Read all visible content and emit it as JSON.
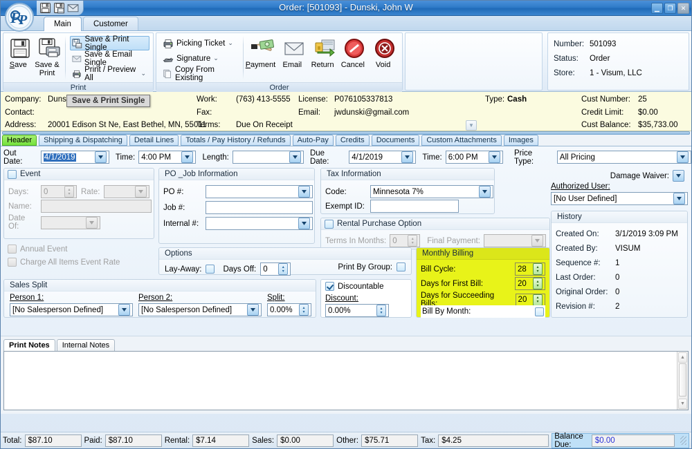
{
  "window": {
    "title": "Order: [501093] - Dunski, John W",
    "minimize": "_",
    "maximize": "□",
    "close": "✕",
    "quick_access": [
      "save-icon",
      "save-print-icon",
      "email-icon"
    ],
    "logo": "fp-magnifier-logo"
  },
  "ribbon": {
    "tabs": [
      {
        "label": "Main",
        "active": true
      },
      {
        "label": "Customer",
        "active": false
      }
    ],
    "groups": [
      {
        "title": "Print",
        "big_buttons": [
          {
            "label_line1": "Save",
            "label_line2": "",
            "icon": "floppy-disk-icon",
            "underline_index": 0
          },
          {
            "label_line1": "Save &",
            "label_line2": "Print",
            "icon": "floppy-printer-icon"
          }
        ],
        "small_buttons": [
          {
            "label": "Save & Print Single",
            "icon": "save-print-single-icon",
            "selected": true,
            "caret": false
          },
          {
            "label": "Save & Email Single",
            "icon": "envelope-icon",
            "selected": false,
            "caret": false
          },
          {
            "label": "Print / Preview All",
            "icon": "printer-icon",
            "selected": false,
            "caret": true
          }
        ]
      },
      {
        "title": "Order",
        "small_buttons": [
          {
            "label": "Picking Ticket",
            "icon": "printer-icon",
            "caret": true
          },
          {
            "label": "Signature",
            "icon": "signature-pad-icon",
            "caret": true
          },
          {
            "label": "Copy From Existing",
            "icon": "copy-document-icon",
            "caret": false
          }
        ],
        "big_buttons": [
          {
            "label_line1": "Payment",
            "icon": "money-hand-icon",
            "underline_index": 0
          },
          {
            "label_line1": "Email",
            "icon": "envelope-icon"
          },
          {
            "label_line1": "Return",
            "icon": "return-box-icon"
          },
          {
            "label_line1": "Cancel",
            "icon": "cancel-circle-icon"
          },
          {
            "label_line1": "Void",
            "icon": "void-circle-icon"
          }
        ]
      }
    ],
    "info": {
      "rows": [
        {
          "key": "Number:",
          "value": "501093"
        },
        {
          "key": "Status:",
          "value": "Order"
        },
        {
          "key": "Store:",
          "value": "1 - Visum, LLC"
        }
      ]
    }
  },
  "tooltip": {
    "text": "Save & Print Single"
  },
  "customer_header": {
    "company_label": "Company:",
    "company_value": "Dunski, John W",
    "contact_label": "Contact:",
    "contact_value": "",
    "address_label": "Address:",
    "address_value": "20001 Edison St Ne, East Bethel, MN, 55011",
    "work_label": "Work:",
    "work_value": "(763) 413-5555",
    "fax_label": "Fax:",
    "fax_value": "",
    "terms_label": "Terms:",
    "terms_value": "Due On Receipt",
    "license_label": "License:",
    "license_value": "P076105337813",
    "email_label": "Email:",
    "email_value": "jwdunski@gmail.com",
    "type_label": "Type:",
    "type_value": "Cash",
    "cust_number_label": "Cust Number:",
    "cust_number_value": "25",
    "credit_limit_label": "Credit Limit:",
    "credit_limit_value": "$0.00",
    "cust_balance_label": "Cust Balance:",
    "cust_balance_value": "$35,733.00"
  },
  "page_tabs": [
    {
      "label": "Header",
      "active": true
    },
    {
      "label": "Shipping & Dispatching",
      "active": false
    },
    {
      "label": "Detail Lines",
      "active": false
    },
    {
      "label": "Totals / Pay History / Refunds",
      "active": false
    },
    {
      "label": "Auto-Pay",
      "active": false
    },
    {
      "label": "Credits",
      "active": false
    },
    {
      "label": "Documents",
      "active": false
    },
    {
      "label": "Custom Attachments",
      "active": false
    },
    {
      "label": "Images",
      "active": false
    }
  ],
  "header_tab": {
    "out_date_label": "Out Date:",
    "out_date_value": "4/1/2019",
    "out_time_label": "Time:",
    "out_time_value": "4:00 PM",
    "length_label": "Length:",
    "length_value": "",
    "due_date_label": "Due Date:",
    "due_date_value": "4/1/2019",
    "due_time_label": "Time:",
    "due_time_value": "6:00 PM",
    "price_type_label": "Price Type:",
    "price_type_value": "All Pricing",
    "event": {
      "title": "Event",
      "checked": false,
      "days_label": "Days:",
      "days_value": "0",
      "rate_label": "Rate:",
      "rate_value": "",
      "name_label": "Name:",
      "name_value": "",
      "date_of_label": "Date Of:",
      "date_of_value": "",
      "annual_event_label": "Annual Event",
      "annual_event_checked": false,
      "charge_all_label": "Charge All Items Event Rate",
      "charge_all_checked": false
    },
    "po_job": {
      "title": "PO _Job Information",
      "po_label": "PO #:",
      "po_value": "",
      "job_label": "Job #:",
      "job_value": "",
      "internal_label": "Internal #:",
      "internal_value": ""
    },
    "tax": {
      "title": "Tax Information",
      "code_label": "Code:",
      "code_value": "Minnesota 7%",
      "exempt_label": "Exempt ID:",
      "exempt_value": ""
    },
    "rpo": {
      "title": "Rental Purchase Option",
      "checked": false,
      "terms_label": "Terms In Months:",
      "terms_value": "0",
      "final_label": "Final Payment:",
      "final_value": ""
    },
    "options": {
      "title": "Options",
      "layaway_label": "Lay-Away:",
      "layaway_checked": false,
      "days_off_label": "Days Off:",
      "days_off_value": "0",
      "print_by_group_label": "Print By Group:",
      "print_by_group_checked": false
    },
    "sales_split": {
      "title": "Sales Split",
      "person1_label": "Person 1:",
      "person1_value": "[No Salesperson Defined]",
      "person2_label": "Person 2:",
      "person2_value": "[No Salesperson Defined]",
      "split_label": "Split:",
      "split_value": "0.00%"
    },
    "discount": {
      "discountable_label": "Discountable",
      "discountable_checked": true,
      "discount_label": "Discount:",
      "discount_value": "0.00%"
    },
    "monthly_billing": {
      "title": "Monthly Billing",
      "bill_cycle_label": "Bill Cycle:",
      "bill_cycle_value": "28",
      "first_bill_label": "Days for First Bill:",
      "first_bill_value": "20",
      "succeeding_label": "Days for Succeeding Bills:",
      "succeeding_value": "20",
      "bill_by_month_label": "Bill By Month:",
      "bill_by_month_checked": false,
      "highlight_color": "#e8f319"
    },
    "damage_waiver_label": "Damage Waiver:",
    "authorized_user_label": "Authorized User:",
    "authorized_user_value": "[No User Defined]",
    "history": {
      "title": "History",
      "rows": [
        {
          "key": "Created On:",
          "value": "3/1/2019 3:09 PM"
        },
        {
          "key": "Created By:",
          "value": "VISUM"
        },
        {
          "key": "Sequence #:",
          "value": "1"
        },
        {
          "key": "Last Order:",
          "value": "0"
        },
        {
          "key": "Original Order:",
          "value": "0"
        },
        {
          "key": "Revision #:",
          "value": "2"
        }
      ]
    }
  },
  "notes": {
    "tabs": [
      {
        "label": "Print Notes",
        "active": true
      },
      {
        "label": "Internal Notes",
        "active": false
      }
    ],
    "content": ""
  },
  "status_bar": {
    "items": [
      {
        "label": "Total:",
        "value": "$87.10"
      },
      {
        "label": "Paid:",
        "value": "$87.10"
      },
      {
        "label": "Rental:",
        "value": "$7.14"
      },
      {
        "label": "Sales:",
        "value": "$0.00"
      },
      {
        "label": "Other:",
        "value": "$75.71"
      },
      {
        "label": "Tax:",
        "value": "$4.25"
      }
    ],
    "balance_due_label": "Balance Due:",
    "balance_due_value": "$0.00",
    "balance_due_color": "#2b31d6"
  }
}
